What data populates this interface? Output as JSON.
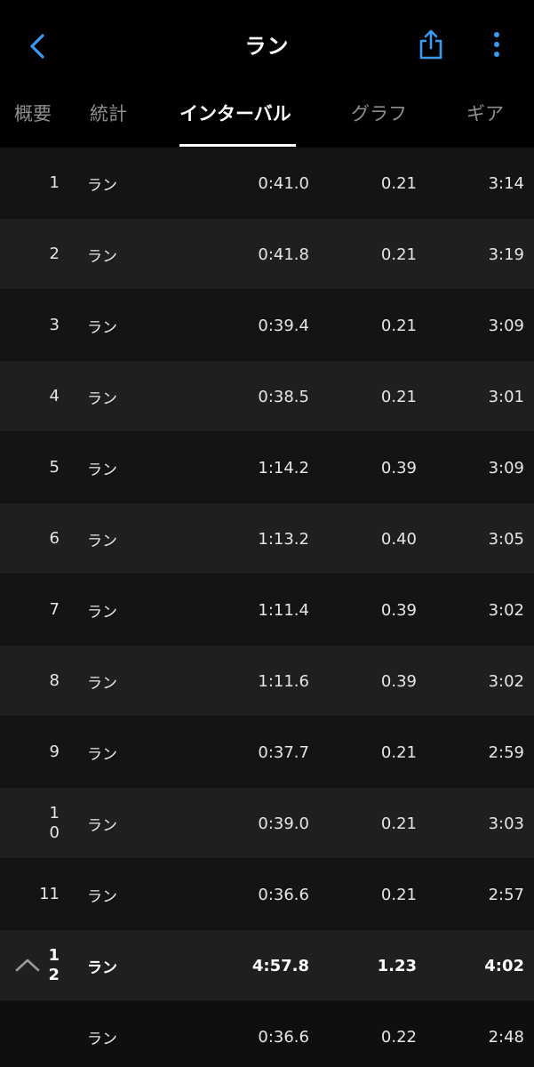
{
  "header": {
    "title": "ラン",
    "back_icon": "chevron-left-icon",
    "share_icon": "share-icon",
    "more_icon": "more-vertical-icon",
    "accent": "#3b9bf0"
  },
  "tabs": [
    {
      "label": "概要",
      "active": false
    },
    {
      "label": "統計",
      "active": false
    },
    {
      "label": "インターバル",
      "active": true
    },
    {
      "label": "グラフ",
      "active": false
    },
    {
      "label": "ギア",
      "active": false
    }
  ],
  "intervals": [
    {
      "num": "1",
      "type": "ラン",
      "time": "0:41.0",
      "distance": "0.21",
      "pace": "3:14"
    },
    {
      "num": "2",
      "type": "ラン",
      "time": "0:41.8",
      "distance": "0.21",
      "pace": "3:19"
    },
    {
      "num": "3",
      "type": "ラン",
      "time": "0:39.4",
      "distance": "0.21",
      "pace": "3:09"
    },
    {
      "num": "4",
      "type": "ラン",
      "time": "0:38.5",
      "distance": "0.21",
      "pace": "3:01"
    },
    {
      "num": "5",
      "type": "ラン",
      "time": "1:14.2",
      "distance": "0.39",
      "pace": "3:09"
    },
    {
      "num": "6",
      "type": "ラン",
      "time": "1:13.2",
      "distance": "0.40",
      "pace": "3:05"
    },
    {
      "num": "7",
      "type": "ラン",
      "time": "1:11.4",
      "distance": "0.39",
      "pace": "3:02"
    },
    {
      "num": "8",
      "type": "ラン",
      "time": "1:11.6",
      "distance": "0.39",
      "pace": "3:02"
    },
    {
      "num": "9",
      "type": "ラン",
      "time": "0:37.7",
      "distance": "0.21",
      "pace": "2:59"
    },
    {
      "num_top": "1",
      "num_bottom": "0",
      "type": "ラン",
      "time": "0:39.0",
      "distance": "0.21",
      "pace": "3:03"
    },
    {
      "num": "11",
      "type": "ラン",
      "time": "0:36.6",
      "distance": "0.21",
      "pace": "2:57"
    },
    {
      "num_top": "1",
      "num_bottom": "2",
      "type": "ラン",
      "time": "4:57.8",
      "distance": "1.23",
      "pace": "4:02",
      "expanded": true
    },
    {
      "num": "",
      "type": "ラン",
      "time": "0:36.6",
      "distance": "0.22",
      "pace": "2:48",
      "sub": true
    }
  ]
}
